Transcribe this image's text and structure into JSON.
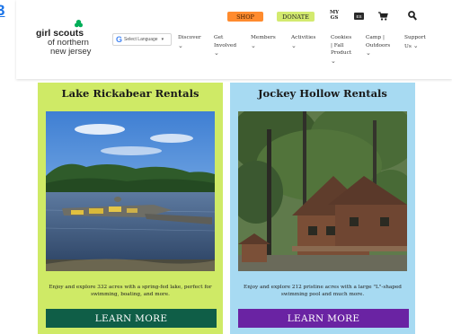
{
  "page": {
    "edge_digit": "3"
  },
  "header": {
    "logo": {
      "line1": "girl scouts",
      "line2": "of northern",
      "line3": "new jersey"
    },
    "language_select": {
      "icon": "G",
      "label": "Select Language"
    },
    "shop_label": "SHOP",
    "donate_label": "DONATE",
    "mygs_line1": "MY",
    "mygs_line2": "GS",
    "es_label": "ES",
    "icons": {
      "cart": "cart-icon",
      "search": "search-icon",
      "leaf": "trefoil-logo-icon"
    },
    "nav": {
      "discover": "Discover",
      "get_involved_1": "Get",
      "get_involved_2": "Involved",
      "members": "Members",
      "activities": "Activities",
      "cookies_1": "Cookies",
      "cookies_2": "| Fall",
      "cookies_3": "Product",
      "camp_1": "Camp |",
      "camp_2": "Outdoors",
      "support_1": "Support",
      "support_2": "Us"
    }
  },
  "cards": {
    "lake": {
      "title": "Lake Rickabear Rentals",
      "description": "Enjoy and explore 332 acres with a spring-fed lake, perfect for swimming, boating, and more.",
      "button": "LEARN MORE"
    },
    "jockey": {
      "title": "Jockey Hollow Rentals",
      "description": "Enjoy and explore 212 pristine acres with a large \"L\"-shaped swimming pool and much more.",
      "button": "LEARN MORE"
    }
  },
  "colors": {
    "lake_card_bg": "#cfea66",
    "jockey_card_bg": "#a7daf2",
    "lake_button": "#0f5e47",
    "jockey_button": "#6a23a3",
    "shop_button": "#ff8b2e",
    "donate_button": "#d3ea6f",
    "brand_green": "#00ae58"
  }
}
